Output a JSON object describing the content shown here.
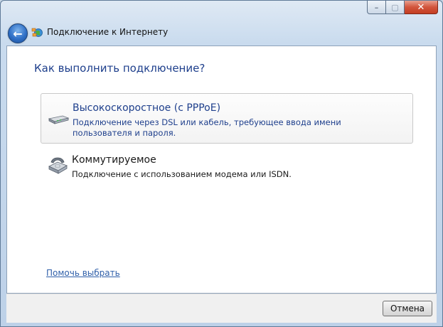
{
  "window": {
    "title": "Подключение к Интернету",
    "caption_minimize": "–",
    "caption_maximize": "▢",
    "caption_close": "✕"
  },
  "nav": {
    "back_icon": "back-arrow-icon"
  },
  "main": {
    "heading": "Как выполнить подключение?",
    "options": [
      {
        "title": "Высокоскоростное (с PPPoE)",
        "description": "Подключение через DSL или кабель, требующее ввода имени пользователя и пароля.",
        "icon": "modem-icon"
      },
      {
        "title": "Коммутируемое",
        "description": "Подключение с использованием модема или ISDN.",
        "icon": "phone-icon"
      }
    ],
    "help_link": "Помочь выбрать"
  },
  "footer": {
    "cancel_label": "Отмена"
  },
  "colors": {
    "accent": "#1e3f8c",
    "link": "#2f5fa9",
    "close": "#c33d22"
  }
}
